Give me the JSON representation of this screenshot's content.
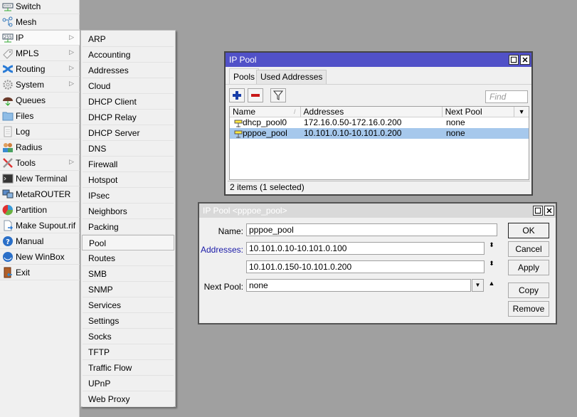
{
  "sidebar": {
    "items": [
      {
        "label": "Switch",
        "icon": "switch-icon",
        "submenu": false
      },
      {
        "label": "Mesh",
        "icon": "mesh-icon",
        "submenu": false
      },
      {
        "label": "IP",
        "icon": "ip-icon",
        "submenu": true
      },
      {
        "label": "MPLS",
        "icon": "mpls-icon",
        "submenu": true
      },
      {
        "label": "Routing",
        "icon": "routing-icon",
        "submenu": true
      },
      {
        "label": "System",
        "icon": "gear-icon",
        "submenu": true
      },
      {
        "label": "Queues",
        "icon": "queues-icon",
        "submenu": false
      },
      {
        "label": "Files",
        "icon": "folder-icon",
        "submenu": false
      },
      {
        "label": "Log",
        "icon": "log-icon",
        "submenu": false
      },
      {
        "label": "Radius",
        "icon": "users-icon",
        "submenu": false
      },
      {
        "label": "Tools",
        "icon": "tools-icon",
        "submenu": true
      },
      {
        "label": "New Terminal",
        "icon": "terminal-icon",
        "submenu": false
      },
      {
        "label": "MetaROUTER",
        "icon": "metarouter-icon",
        "submenu": false
      },
      {
        "label": "Partition",
        "icon": "pie-icon",
        "submenu": false
      },
      {
        "label": "Make Supout.rif",
        "icon": "document-icon",
        "submenu": false
      },
      {
        "label": "Manual",
        "icon": "help-icon",
        "submenu": false
      },
      {
        "label": "New WinBox",
        "icon": "winbox-icon",
        "submenu": false
      },
      {
        "label": "Exit",
        "icon": "exit-door-icon",
        "submenu": false
      }
    ],
    "submenu_arrow": "▷"
  },
  "ip_submenu": {
    "items": [
      "ARP",
      "Accounting",
      "Addresses",
      "Cloud",
      "DHCP Client",
      "DHCP Relay",
      "DHCP Server",
      "DNS",
      "Firewall",
      "Hotspot",
      "IPsec",
      "Neighbors",
      "Packing",
      "Pool",
      "Routes",
      "SMB",
      "SNMP",
      "Services",
      "Settings",
      "Socks",
      "TFTP",
      "Traffic Flow",
      "UPnP",
      "Web Proxy"
    ],
    "active": "Pool"
  },
  "pool_window": {
    "title": "IP Pool",
    "maximize_icon": "☐",
    "close_icon": "✕",
    "tabs": [
      "Pools",
      "Used Addresses"
    ],
    "active_tab": "Pools",
    "toolbar": {
      "add": "+",
      "remove": "−",
      "filter": "filter-icon"
    },
    "find_placeholder": "Find",
    "columns": [
      "Name",
      "Addresses",
      "Next Pool"
    ],
    "sort_indicator": "/",
    "column_menu": "▼",
    "rows": [
      {
        "name": "dhcp_pool0",
        "addresses": "172.16.0.50-172.16.0.200",
        "next_pool": "none",
        "selected": false
      },
      {
        "name": "pppoe_pool",
        "addresses": "10.101.0.10-10.101.0.200",
        "next_pool": "none",
        "selected": true
      }
    ],
    "status": "2 items (1 selected)"
  },
  "edit_window": {
    "title": "IP Pool <pppoe_pool>",
    "maximize_icon": "☐",
    "close_icon": "✕",
    "fields": {
      "name_label": "Name:",
      "name_value": "pppoe_pool",
      "addresses_label": "Addresses:",
      "addresses": [
        "10.101.0.10-10.101.0.100",
        "10.101.0.150-10.101.0.200"
      ],
      "next_pool_label": "Next Pool:",
      "next_pool_value": "none"
    },
    "spin_icon": "⬍",
    "dropdown_icon": "▼",
    "up_icon": "▲",
    "buttons": {
      "ok": "OK",
      "cancel": "Cancel",
      "apply": "Apply",
      "copy": "Copy",
      "remove": "Remove"
    }
  }
}
